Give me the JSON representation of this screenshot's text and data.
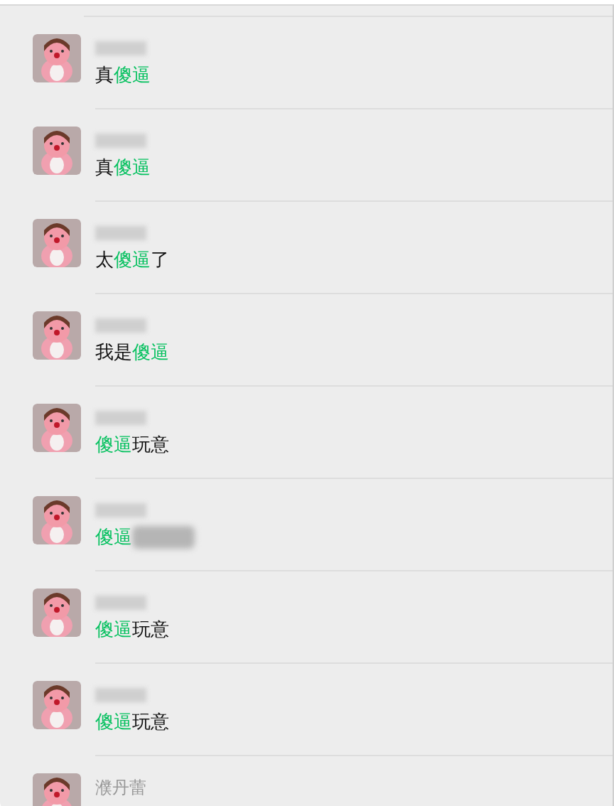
{
  "results": [
    {
      "message": [
        {
          "kind": "plain",
          "text": "真"
        },
        {
          "kind": "match",
          "text": "傻逼"
        }
      ]
    },
    {
      "message": [
        {
          "kind": "plain",
          "text": "真"
        },
        {
          "kind": "match",
          "text": "傻逼"
        }
      ]
    },
    {
      "message": [
        {
          "kind": "plain",
          "text": "太"
        },
        {
          "kind": "match",
          "text": "傻逼"
        },
        {
          "kind": "plain",
          "text": "了"
        }
      ]
    },
    {
      "message": [
        {
          "kind": "plain",
          "text": "我是"
        },
        {
          "kind": "match",
          "text": "傻逼"
        }
      ]
    },
    {
      "message": [
        {
          "kind": "match",
          "text": "傻逼"
        },
        {
          "kind": "plain",
          "text": "玩意"
        }
      ]
    },
    {
      "message": [
        {
          "kind": "match",
          "text": "傻逼"
        },
        {
          "kind": "blurred"
        }
      ]
    },
    {
      "message": [
        {
          "kind": "match",
          "text": "傻逼"
        },
        {
          "kind": "plain",
          "text": "玩意"
        }
      ]
    },
    {
      "message": [
        {
          "kind": "match",
          "text": "傻逼"
        },
        {
          "kind": "plain",
          "text": "玩意"
        }
      ]
    },
    {
      "name": "濮丹蕾"
    }
  ]
}
